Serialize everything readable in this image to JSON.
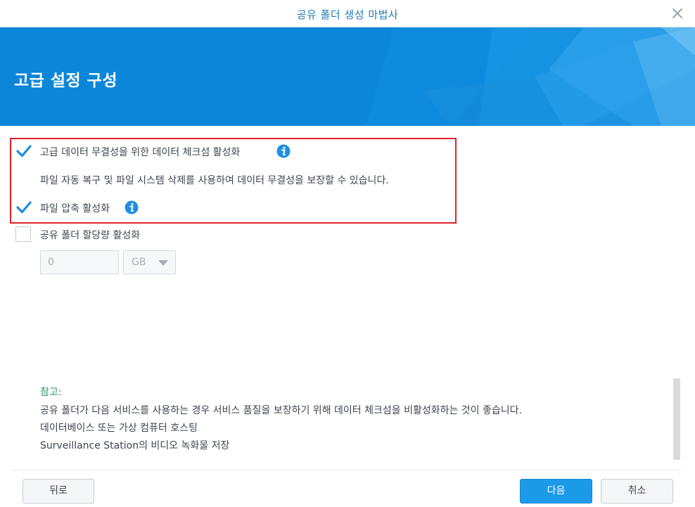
{
  "window": {
    "title": "공유 폴더 생성 마법사",
    "close_icon": "close-icon"
  },
  "banner": {
    "title": "고급 설정 구성"
  },
  "options": {
    "checksum": {
      "label": "고급 데이터 무결성을 위한 데이터 체크섬 활성화",
      "checked": true,
      "description": "파일 자동 복구 및 파일 시스템 삭제를 사용하여 데이터 무결성을 보장할 수 있습니다."
    },
    "compression": {
      "label": "파일 압축 활성화",
      "checked": true
    },
    "quota": {
      "label": "공유 폴더 할당량 활성화",
      "checked": false,
      "value": "0",
      "unit": "GB"
    }
  },
  "note": {
    "title": "참고:",
    "lines": [
      "공유 폴더가 다음 서비스를 사용하는 경우 서비스 품질을 보장하기 위해 데이터 체크섬을 비활성화하는 것이 좋습니다.",
      "데이터베이스 또는 가상 컴퓨터 호스팅",
      "Surveillance Station의 비디오 녹화물 저장"
    ]
  },
  "buttons": {
    "back": "뒤로",
    "next": "다음",
    "cancel": "취소"
  },
  "colors": {
    "accent": "#0d85d6",
    "primary_button": "#1b9ae8",
    "highlight_border": "#e0232e",
    "note_title": "#1a9a5b",
    "title_text": "#1c7bb3"
  }
}
